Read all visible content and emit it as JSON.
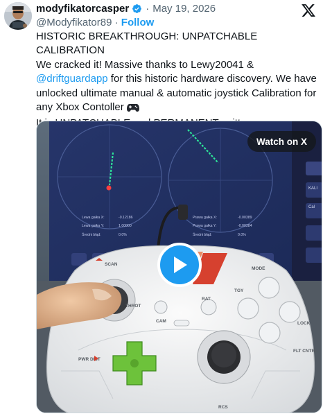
{
  "post": {
    "display_name": "modyfikatorcasper",
    "date": "May 19, 2026",
    "separator": "·",
    "handle": "@Modyfikator89",
    "follow_label": "Follow",
    "text": {
      "line1": "HISTORIC BREAKTHROUGH: UNPATCHABLE CALIBRATION",
      "line2": "We cracked it! Massive thanks to Lewy20041 &",
      "mention": "@driftguardapp",
      "line3_after_mention": " for this historic hardware discovery. We have unlocked ultimate manual & automatic joystick Calibration for any Xbox Contoller",
      "emoji": "🎮",
      "line4": "It is UNPATCHABLE and PERMANENT written"
    }
  },
  "media": {
    "watch_label": "Watch on X",
    "screen_labels": {
      "left_x": "Lewa gałka X:",
      "left_x_val": "-0.12186",
      "left_y": "Lewa gałka Y:",
      "left_y_val": "1.00000",
      "left_err": "Średni błąd:",
      "left_err_val": "0.0%",
      "right_x": "Prawa gałka X:",
      "right_x_val": "-0.00389",
      "right_y": "Prawa gałka Y:",
      "right_y_val": "-0.00384",
      "right_err": "Średni błąd:",
      "right_err_val": "0.0%",
      "side_cal": "Cal",
      "side_kal": "KALI"
    },
    "controller_labels": {
      "scan": "SCAN",
      "throt": "THROT",
      "cam": "CAM",
      "rat": "RAT",
      "mode": "MODE",
      "tgy": "TGY",
      "lock": "LOCK",
      "flt_cntrl": "FLT CNTRL",
      "pwr_dist": "PWR DIST",
      "rcs": "RCS"
    }
  },
  "colors": {
    "accent": "#1d9bf0",
    "text": "#0f1419",
    "muted": "#536471",
    "dpad_green": "#6dc23b"
  },
  "icons": {
    "verified": "verified-badge-icon",
    "x_logo": "x-logo-icon",
    "play": "play-icon"
  }
}
